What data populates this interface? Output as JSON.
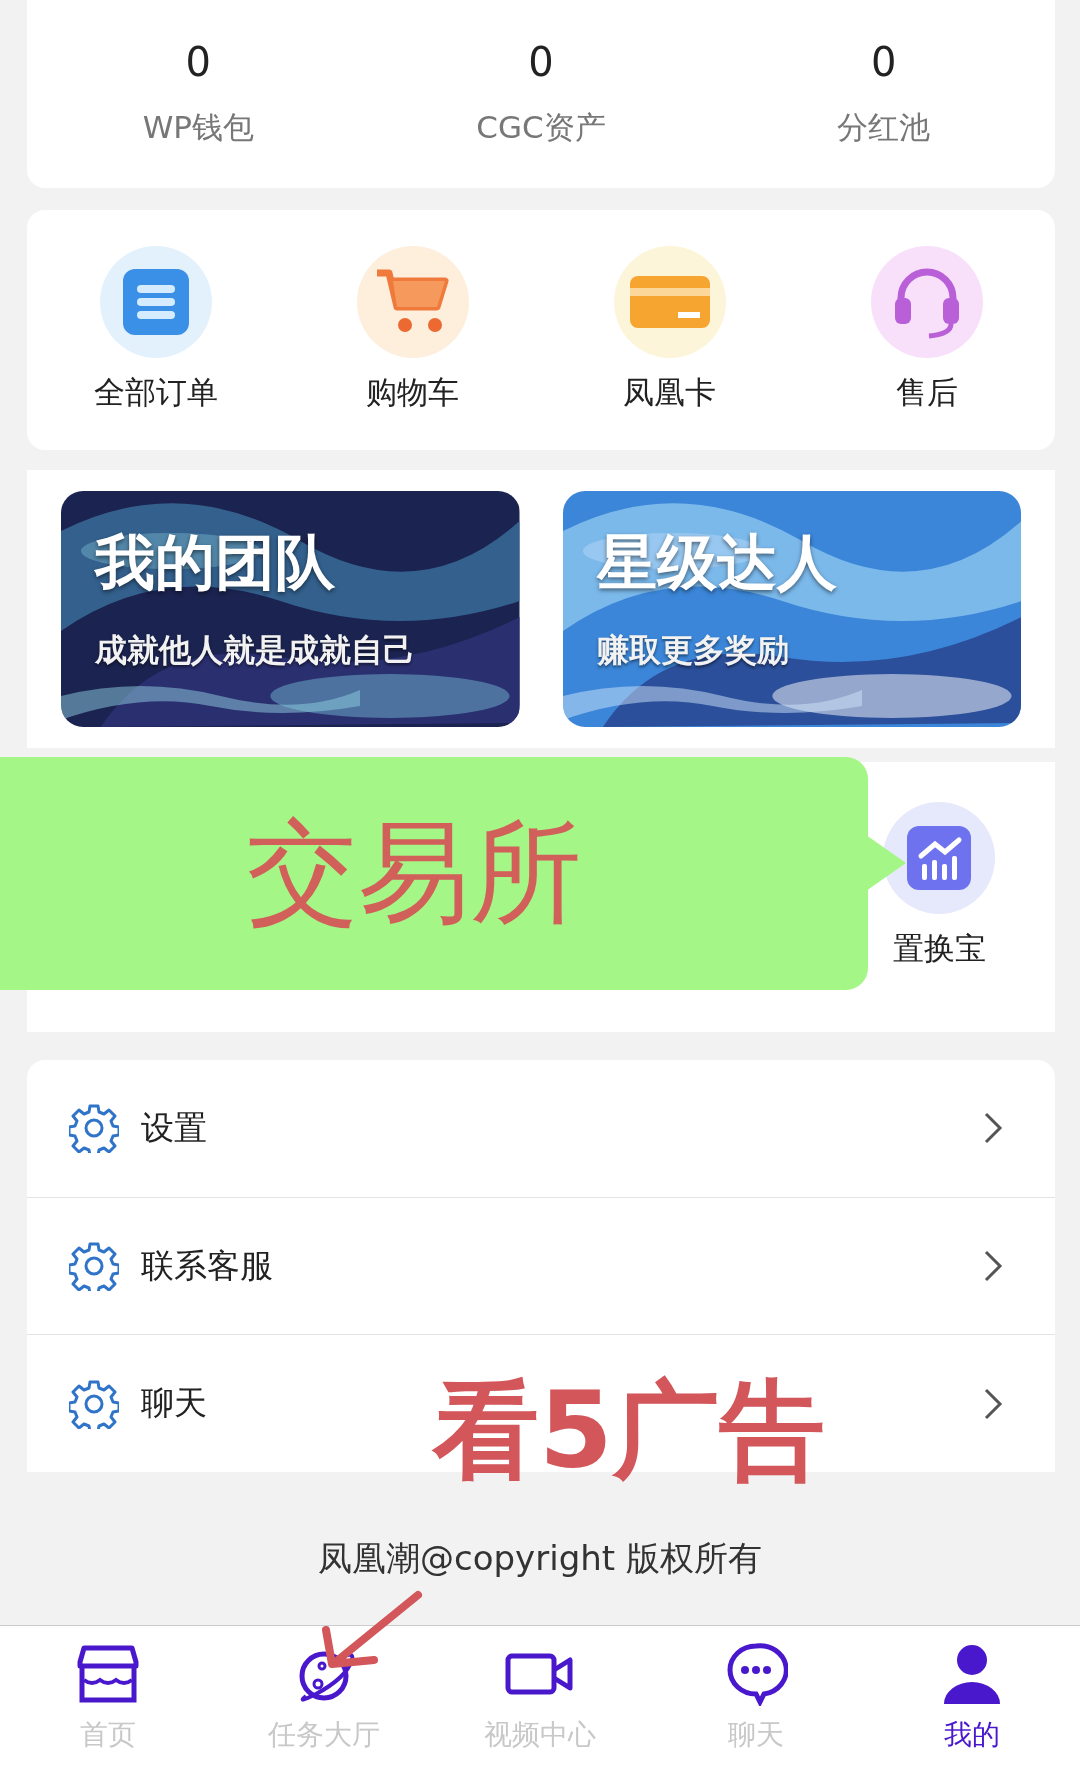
{
  "stats": [
    {
      "value": "0",
      "label": "WP钱包"
    },
    {
      "value": "0",
      "label": "CGC资产"
    },
    {
      "value": "0",
      "label": "分红池"
    }
  ],
  "shortcuts": [
    {
      "kind": "orders",
      "label": "全部订单"
    },
    {
      "kind": "cart",
      "label": "购物车"
    },
    {
      "kind": "card",
      "label": "凤凰卡"
    },
    {
      "kind": "service",
      "label": "售后"
    }
  ],
  "banners": [
    {
      "kind": "picture",
      "title": "我的团队",
      "subtitle": "成就他人就是成就自己"
    },
    {
      "kind": "picture",
      "title": "星级达人",
      "subtitle": "赚取更多奖励"
    }
  ],
  "tools": [
    {
      "kind": "chart",
      "label": "置换宝"
    }
  ],
  "menu": [
    {
      "label": "设置"
    },
    {
      "label": "联系客服"
    },
    {
      "label": "聊天"
    }
  ],
  "footer": "凤凰潮@copyright 版权所有",
  "nav": [
    {
      "kind": "home",
      "label": "首页",
      "selected": false
    },
    {
      "kind": "planet",
      "label": "任务大厅",
      "selected": false
    },
    {
      "kind": "video",
      "label": "视频中心",
      "selected": false
    },
    {
      "kind": "chat",
      "label": "聊天",
      "selected": false
    },
    {
      "kind": "user",
      "label": "我的",
      "selected": true
    }
  ],
  "annotations": [
    {
      "kind": "callout",
      "text": "交易所"
    },
    {
      "kind": "label",
      "text": "看5广告"
    },
    {
      "kind": "arrow"
    }
  ]
}
